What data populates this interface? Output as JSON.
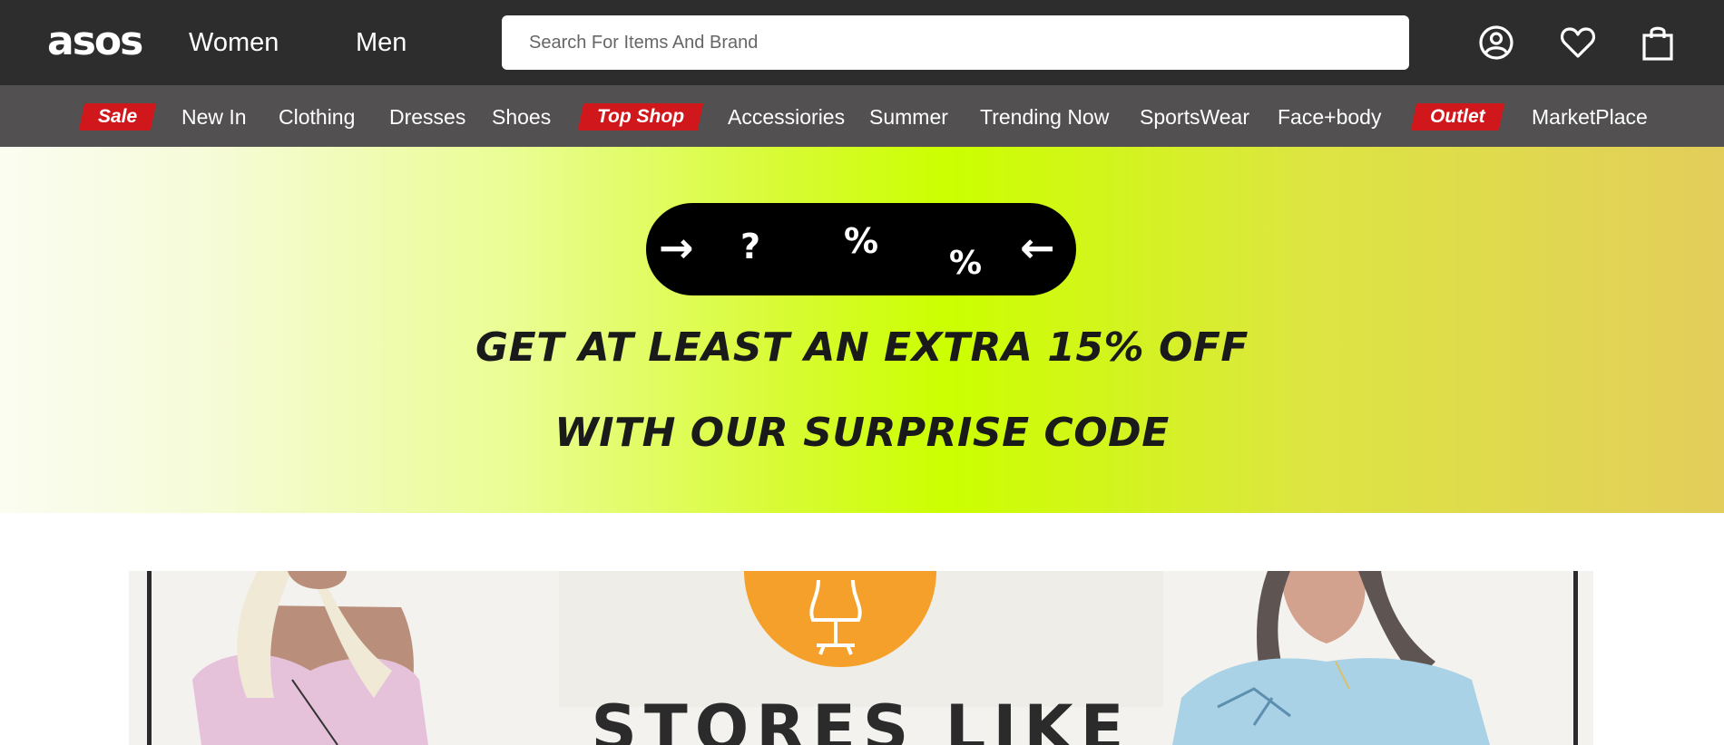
{
  "header": {
    "logo": "asos",
    "nav": [
      {
        "label": "Women"
      },
      {
        "label": "Men"
      }
    ],
    "search": {
      "placeholder": "Search For Items And Brand",
      "value": ""
    },
    "icons": [
      "account-icon",
      "heart-icon",
      "shopping-bag-icon"
    ]
  },
  "categories": [
    {
      "label": "Sale",
      "badge": true
    },
    {
      "label": "New In",
      "badge": false
    },
    {
      "label": "Clothing",
      "badge": false
    },
    {
      "label": "Dresses",
      "badge": false
    },
    {
      "label": "Shoes",
      "badge": false
    },
    {
      "label": "Top Shop",
      "badge": true
    },
    {
      "label": "Accessiories",
      "badge": false
    },
    {
      "label": "Summer",
      "badge": false
    },
    {
      "label": "Trending Now",
      "badge": false
    },
    {
      "label": "SportsWear",
      "badge": false
    },
    {
      "label": "Face+body",
      "badge": false
    },
    {
      "label": "Outlet",
      "badge": true
    },
    {
      "label": "MarketPlace",
      "badge": false
    }
  ],
  "promo": {
    "pill_glyphs": [
      "→",
      "?",
      "%",
      "%",
      "←"
    ],
    "line1": "GET AT LEAST AN EXTRA 15% OFF",
    "line2": "WITH OUR SURPRISE CODE"
  },
  "feature": {
    "heading": "STORES LIKE"
  },
  "colors": {
    "header_bg": "#2d2d2d",
    "category_bg": "#525050",
    "badge_red": "#d0181c",
    "promo_lime": "#ccff00"
  }
}
